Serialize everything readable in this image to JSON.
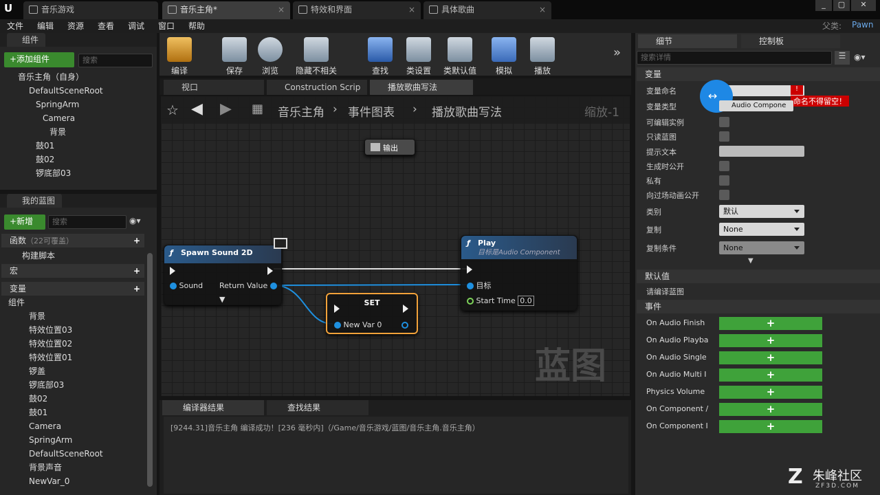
{
  "tabs": [
    {
      "label": "音乐游戏"
    },
    {
      "label": "音乐主角*"
    },
    {
      "label": "特效和界面"
    },
    {
      "label": "具体歌曲"
    }
  ],
  "parent_label": "父类:",
  "parent_value": "Pawn",
  "menu": [
    "文件",
    "编辑",
    "资源",
    "查看",
    "调试",
    "窗口",
    "帮助"
  ],
  "components_panel": {
    "title": "组件",
    "add_button": "+添加组件",
    "search_placeholder": "搜索",
    "self_label": "音乐主角（自身）",
    "tree": [
      "DefaultSceneRoot",
      "SpringArm",
      "Camera",
      "背景",
      "鼓01",
      "鼓02",
      "锣底部03"
    ]
  },
  "toolbar": [
    "编译",
    "保存",
    "浏览",
    "隐藏不相关",
    "查找",
    "类设置",
    "类默认值",
    "模拟",
    "播放"
  ],
  "editor_tabs": [
    "视口",
    "Construction Scrip",
    "播放歌曲写法"
  ],
  "breadcrumb": {
    "root": "音乐主角",
    "graph": "事件图表",
    "function": "播放歌曲写法",
    "zoom": "缩放-1"
  },
  "graph": {
    "output_node": "输出",
    "spawn_title": "Spawn Sound 2D",
    "spawn_sound": "Sound",
    "spawn_return": "Return Value",
    "play_title": "Play",
    "play_subtitle": "目标是Audio Component",
    "play_target": "目标",
    "play_start": "Start Time",
    "play_start_value": "0.0",
    "set_title": "SET",
    "set_var": "New Var 0",
    "watermark": "蓝图"
  },
  "my_blueprint": {
    "title": "我的蓝图",
    "new_button": "+新增",
    "search_placeholder": "搜索",
    "functions": "函数",
    "functions_note": "（22可覆盖）",
    "construct": "构建脚本",
    "macros": "宏",
    "variables": "变量",
    "components": "组件",
    "items": [
      "背景",
      "特效位置03",
      "特效位置02",
      "特效位置01",
      "锣盖",
      "锣底部03",
      "鼓02",
      "鼓01",
      "Camera",
      "SpringArm",
      "DefaultSceneRoot",
      "背景声音",
      "NewVar_0"
    ]
  },
  "results_tabs": [
    "编译器结果",
    "查找结果"
  ],
  "results_log": "[9244.31]音乐主角 编译成功！[236 毫秒内]（/Game/音乐游戏/蓝图/音乐主角.音乐主角）",
  "details": {
    "tab_details": "细节",
    "tab_control": "控制板",
    "search_placeholder": "搜索详情",
    "section_var": "变量",
    "props": [
      "变量命名",
      "变量类型",
      "可编辑实例",
      "只读蓝图",
      "提示文本",
      "生成时公开",
      "私有",
      "向过场动画公开",
      "类别",
      "复制",
      "复制条件"
    ],
    "var_type_value": "Audio Compone",
    "error_msg": "命名不得留空！",
    "category_value": "默认",
    "replicate_value": "None",
    "rep_cond_value": "None",
    "section_default": "默认值",
    "default_note": "请编译蓝图",
    "section_events": "事件",
    "events": [
      "On Audio Finish",
      "On Audio Playba",
      "On Audio Single",
      "On Audio Multi I",
      "Physics Volume",
      "On Component /",
      "On Component I"
    ]
  },
  "logo": {
    "brand": "朱峰社区",
    "site": "ZF3D.COM"
  }
}
